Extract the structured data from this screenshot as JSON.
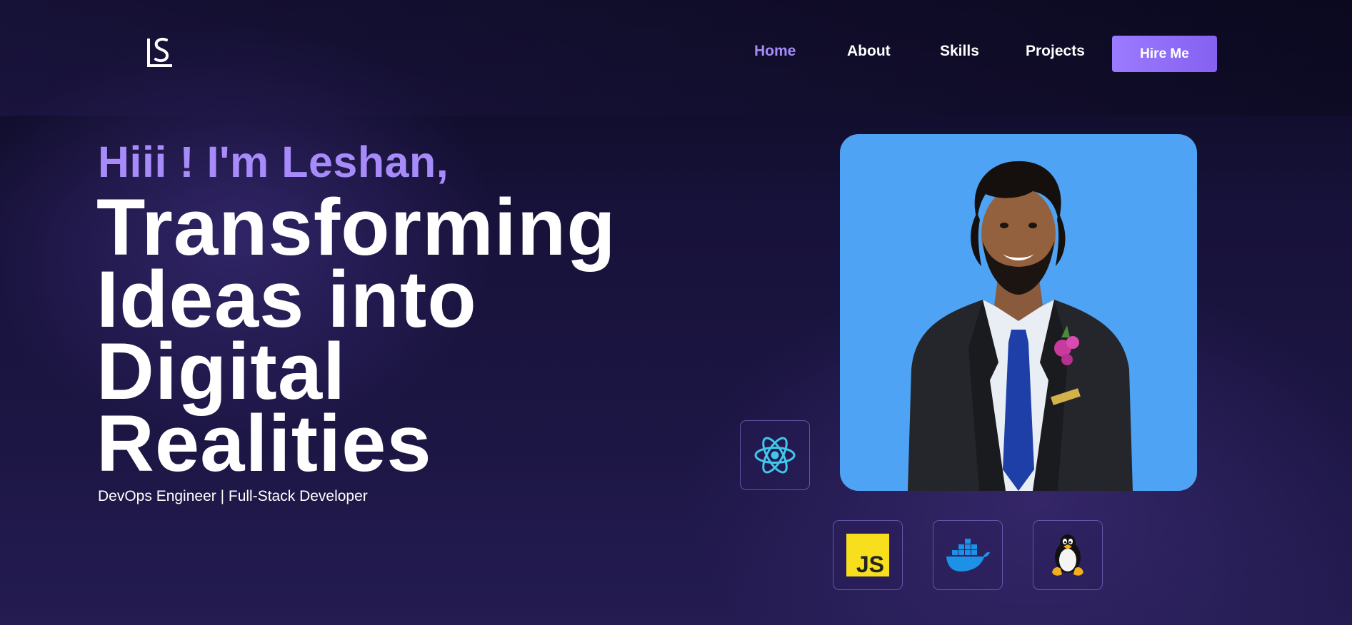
{
  "header": {
    "logo_text": "LS",
    "nav": [
      {
        "label": "Home",
        "active": true
      },
      {
        "label": "About",
        "active": false
      },
      {
        "label": "Skills",
        "active": false
      },
      {
        "label": "Projects",
        "active": false
      }
    ],
    "cta_label": "Hire Me"
  },
  "hero": {
    "greeting": "Hiii ! I'm Leshan,",
    "headline": [
      "Transforming",
      "Ideas into",
      "Digital",
      "Realities"
    ],
    "subtitle": "DevOps Engineer | Full-Stack Developer"
  },
  "tech_icons": [
    {
      "name": "react-icon"
    },
    {
      "name": "javascript-icon",
      "label": "JS"
    },
    {
      "name": "docker-icon"
    },
    {
      "name": "linux-tux-icon"
    }
  ],
  "colors": {
    "accent": "#a78bfa",
    "button": "#8b6cf6",
    "photo_bg": "#4fa3f4",
    "background": "#1a1540"
  }
}
